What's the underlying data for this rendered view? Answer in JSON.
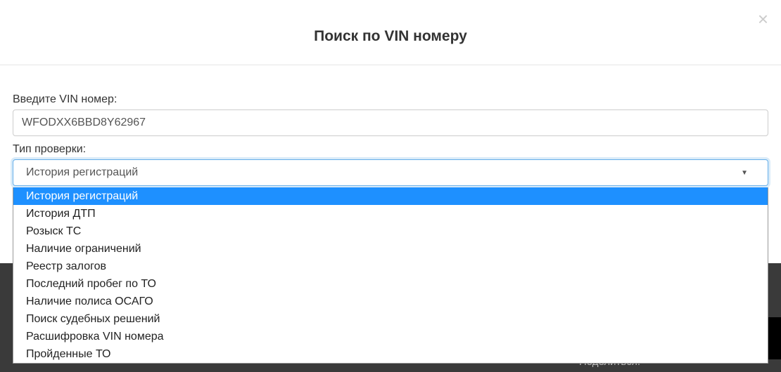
{
  "modal": {
    "title": "Поиск по VIN номеру",
    "close": "×"
  },
  "form": {
    "vin_label": "Введите VIN номер:",
    "vin_value": "WFODXX6BBD8Y62967",
    "check_type_label": "Тип проверки:",
    "selected_option": "История регистраций"
  },
  "dropdown": {
    "options": [
      "История регистраций",
      "История ДТП",
      "Розыск ТС",
      "Наличие ограничений",
      "Реестр залогов",
      "Последний пробег по ТО",
      "Наличие полиса ОСАГО",
      "Поиск судебных решений",
      "Расшифровка VIN номера",
      "Пройденные ТО"
    ],
    "selected_index": 0
  },
  "footer": {
    "hint": "Поделиться:"
  }
}
